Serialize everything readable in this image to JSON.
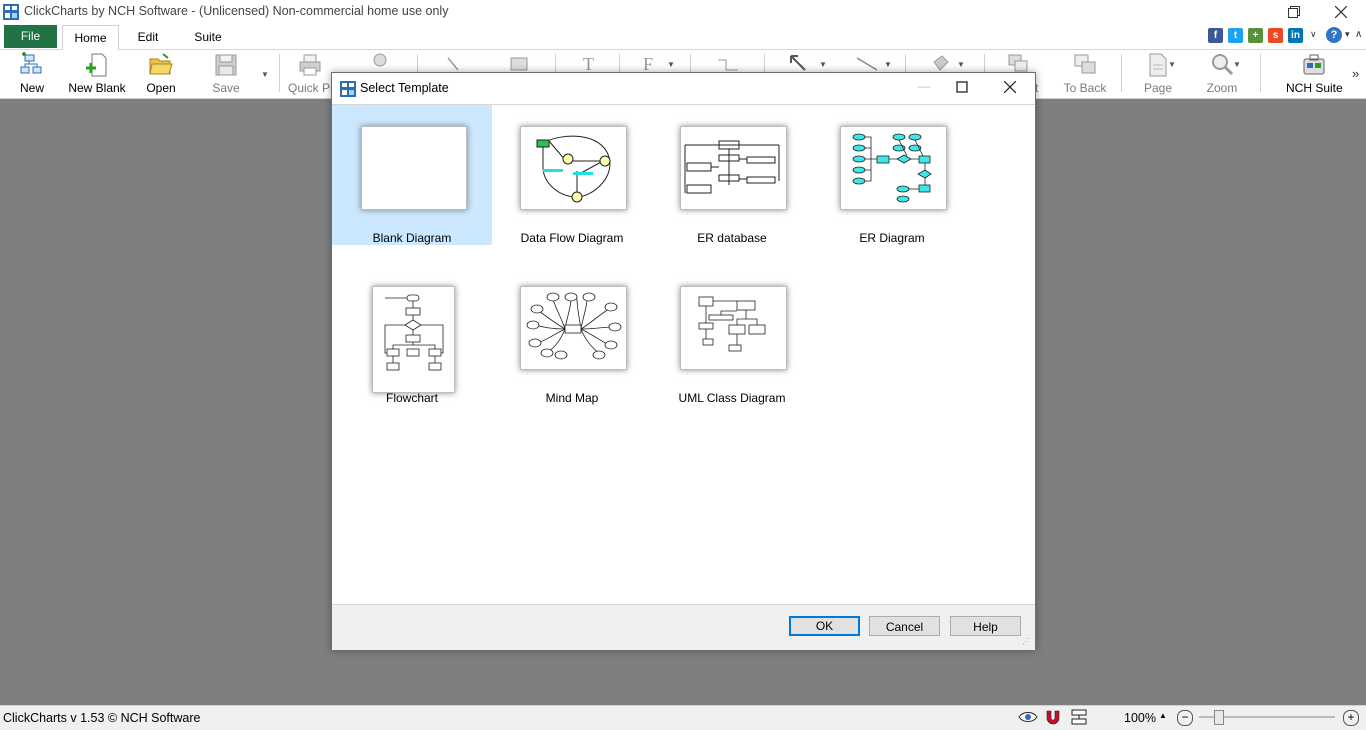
{
  "window": {
    "title": "ClickCharts by NCH Software - (Unlicensed) Non-commercial home use only"
  },
  "menu_tabs": [
    "File",
    "Home",
    "Edit",
    "Suite"
  ],
  "social_icons": [
    "facebook-icon",
    "twitter-icon",
    "share-icon",
    "stumbleupon-icon",
    "linkedin-icon"
  ],
  "ribbon": {
    "new": "New",
    "new_blank": "New Blank",
    "open": "Open",
    "save": "Save",
    "quick_print": "Quick Pri",
    "to_back_partial": "t",
    "to_back": "To Back",
    "page": "Page",
    "zoom": "Zoom",
    "nch_suite": "NCH Suite"
  },
  "dialog": {
    "title": "Select Template",
    "templates": [
      {
        "label": "Blank Diagram",
        "selected": true
      },
      {
        "label": "Data Flow Diagram",
        "selected": false
      },
      {
        "label": "ER database",
        "selected": false
      },
      {
        "label": "ER Diagram",
        "selected": false
      },
      {
        "label": "Flowchart",
        "selected": false
      },
      {
        "label": "Mind Map",
        "selected": false
      },
      {
        "label": "UML Class Diagram",
        "selected": false
      }
    ],
    "buttons": {
      "ok": "OK",
      "cancel": "Cancel",
      "help": "Help"
    }
  },
  "status": {
    "text": "ClickCharts v 1.53 © NCH Software",
    "zoom": "100%"
  },
  "colors": {
    "file_tab": "#217346",
    "selection": "#cce8ff",
    "workspace": "#7f7f7f",
    "default_button_border": "#0078d7"
  }
}
